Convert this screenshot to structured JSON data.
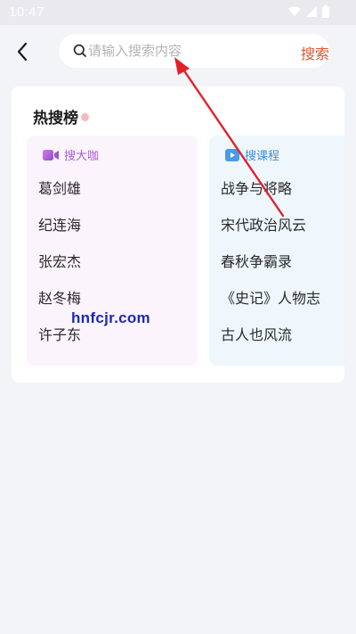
{
  "status_bar": {
    "time": "10:47"
  },
  "header": {
    "search_placeholder": "请输入搜索内容",
    "search_button": "搜索"
  },
  "hot_search": {
    "title": "热搜榜",
    "panels": [
      {
        "label": "搜大咖",
        "icon": "video-camera-icon",
        "color": "#a760d4",
        "items": [
          "葛剑雄",
          "纪连海",
          "张宏杰",
          "赵冬梅",
          "许子东"
        ]
      },
      {
        "label": "搜课程",
        "icon": "play-icon",
        "color": "#3f8fd8",
        "items": [
          "战争与将略",
          "宋代政治风云",
          "春秋争霸录",
          "《史记》人物志",
          "古人也风流"
        ]
      }
    ]
  },
  "watermark": "hnfcjr.com",
  "accent_color": "#e8542f",
  "annotation_color": "#e3202a"
}
